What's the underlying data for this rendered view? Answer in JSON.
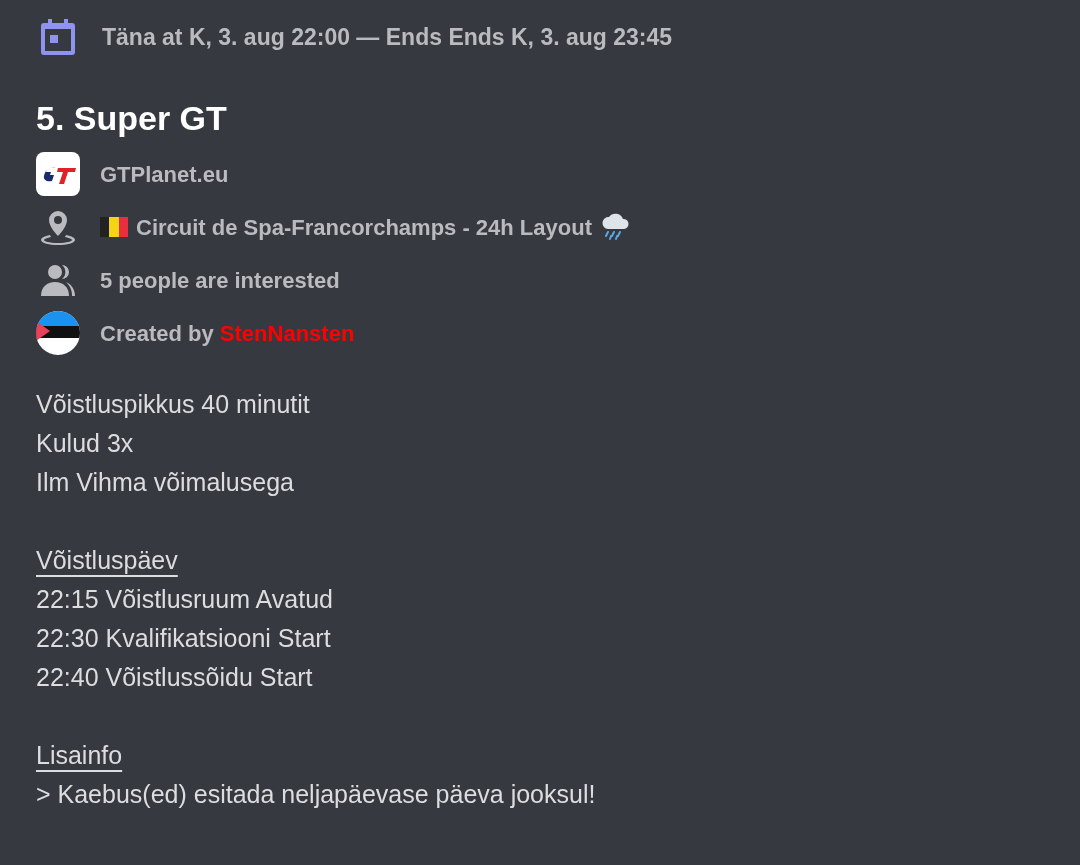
{
  "event_time": "Täna at K, 3. aug 22:00 — Ends Ends K, 3. aug 23:45",
  "title": "5. Super GT",
  "details": [
    {
      "kind": "server",
      "text": "GTPlanet.eu"
    },
    {
      "kind": "location",
      "text": "Circuit de Spa-Francorchamps - 24h Layout"
    },
    {
      "kind": "interest",
      "text": "5 people are interested"
    },
    {
      "kind": "creator",
      "text": "Created by",
      "name": "StenNansten"
    }
  ],
  "description": [
    {
      "lines": [
        "Võistluspikkus 40 minutit",
        "Kulud 3x",
        "Ilm Vihma võimalusega"
      ]
    },
    {
      "heading": "Võistluspäev",
      "lines": [
        "22:15 Võistlusruum Avatud",
        "22:30 Kvalifikatsiooni Start",
        "22:40 Võistlussõidu Start"
      ]
    },
    {
      "heading": "Lisainfo",
      "lines": [
        "> Kaebus(ed) esitada neljapäevase päeva jooksul!"
      ]
    }
  ]
}
